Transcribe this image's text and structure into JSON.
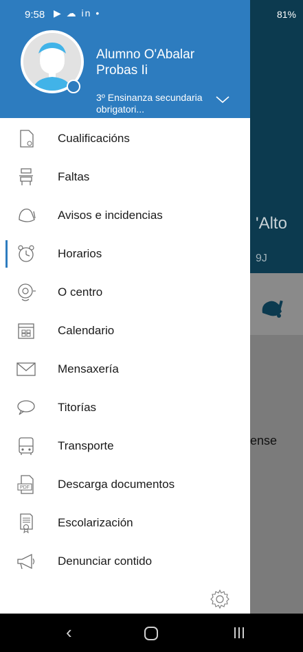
{
  "status_bar": {
    "time": "9:58",
    "icons_left": "▶ ☁ in •",
    "battery": "81%"
  },
  "background": {
    "text_1": "'Alto",
    "text_2": "9J",
    "text_3": "ense"
  },
  "drawer": {
    "header": {
      "name": "Alumno O'Abalar Probas Ii",
      "course": "3º Ensinanza secundaria obrigatori..."
    },
    "items": [
      {
        "label": "Cualificacións",
        "icon": "document-check-icon"
      },
      {
        "label": "Faltas",
        "icon": "desk-icon"
      },
      {
        "label": "Avisos e incidencias",
        "icon": "bell-icon"
      },
      {
        "label": "Horarios",
        "icon": "alarm-clock-icon",
        "active": true
      },
      {
        "label": "O centro",
        "icon": "school-bell-icon"
      },
      {
        "label": "Calendario",
        "icon": "calendar-icon"
      },
      {
        "label": "Mensaxería",
        "icon": "envelope-icon"
      },
      {
        "label": "Titorías",
        "icon": "chat-bubble-icon"
      },
      {
        "label": "Transporte",
        "icon": "bus-icon"
      },
      {
        "label": "Descarga documentos",
        "icon": "pdf-icon"
      },
      {
        "label": "Escolarización",
        "icon": "certificate-icon"
      },
      {
        "label": "Denunciar contido",
        "icon": "megaphone-icon"
      }
    ],
    "settings_icon": "gear-icon"
  },
  "colors": {
    "header_blue": "#2d7cbf",
    "dark_teal": "#0c3a4f",
    "active_bar": "#2d7cbf"
  }
}
